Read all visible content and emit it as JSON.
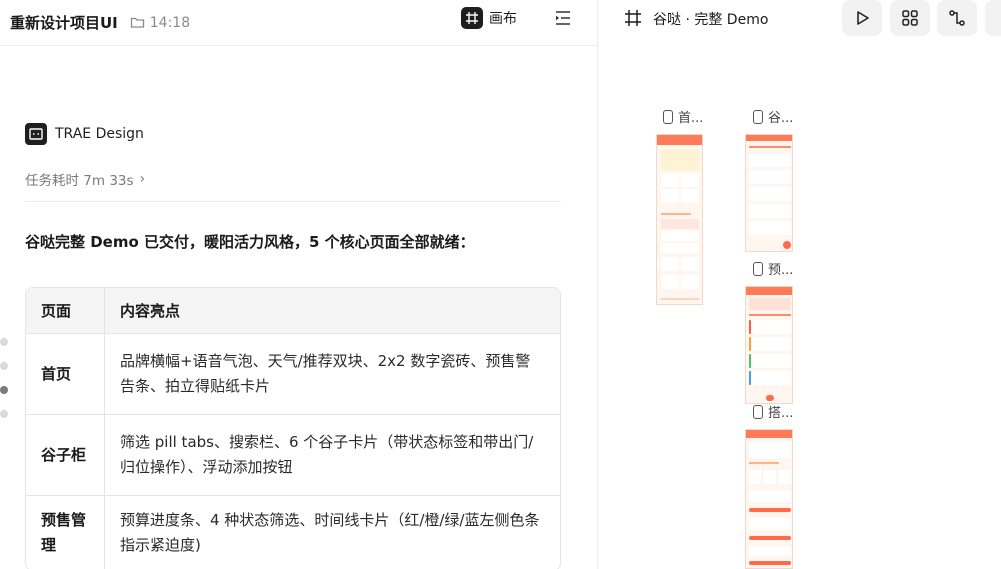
{
  "header": {
    "project_title": "重新设计项目UI",
    "time": "14:18",
    "canvas_label": "画布"
  },
  "message": {
    "brand": "TRAE Design",
    "task_time": "任务耗时 7m 33s",
    "summary": "谷哒完整 Demo 已交付，暖阳活力风格，5 个核心页面全部就绪："
  },
  "table": {
    "headers": [
      "页面",
      "内容亮点"
    ],
    "rows": [
      {
        "page": "首页",
        "highlight": "品牌横幅+语音气泡、天气/推荐双块、2x2 数字瓷砖、预售警告条、拍立得贴纸卡片"
      },
      {
        "page": "谷子柜",
        "highlight": "筛选 pill tabs、搜索栏、6 个谷子卡片（带状态标签和带出门/归位操作）、浮动添加按钮"
      },
      {
        "page": "预售管理",
        "highlight": "预算进度条、4 种状态筛选、时间线卡片（红/橙/绿/蓝左侧色条指示紧迫度)"
      }
    ]
  },
  "preview": {
    "title": "谷哒 · 完整 Demo",
    "frames": [
      {
        "label": "首..."
      },
      {
        "label": "谷..."
      },
      {
        "label": "预..."
      },
      {
        "label": "搭..."
      }
    ]
  },
  "icons": {
    "folder": "folder-icon",
    "canvas": "canvas-frame-icon",
    "outline": "outline-toggle-icon",
    "frame": "frame-icon",
    "play": "play-icon",
    "grid": "grid-icon",
    "flow": "flow-icon",
    "brand": "trae-logo-icon",
    "device": "phone-icon"
  },
  "colors": {
    "accent": "#ff7a59",
    "phone_bg": "#fff7ef",
    "dark": "#1f1f1f"
  }
}
